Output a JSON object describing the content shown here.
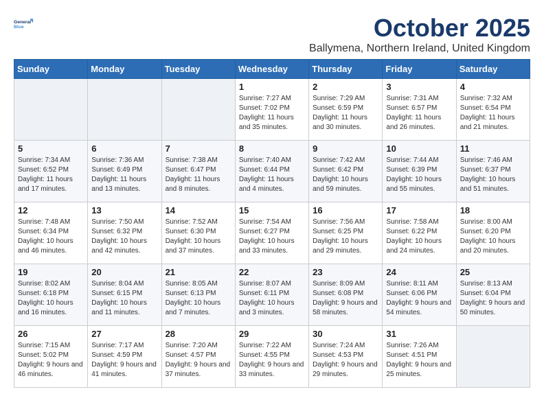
{
  "header": {
    "logo_line1": "General",
    "logo_line2": "Blue",
    "title": "October 2025",
    "subtitle": "Ballymena, Northern Ireland, United Kingdom"
  },
  "weekdays": [
    "Sunday",
    "Monday",
    "Tuesday",
    "Wednesday",
    "Thursday",
    "Friday",
    "Saturday"
  ],
  "weeks": [
    [
      {
        "day": "",
        "sunrise": "",
        "sunset": "",
        "daylight": ""
      },
      {
        "day": "",
        "sunrise": "",
        "sunset": "",
        "daylight": ""
      },
      {
        "day": "",
        "sunrise": "",
        "sunset": "",
        "daylight": ""
      },
      {
        "day": "1",
        "sunrise": "Sunrise: 7:27 AM",
        "sunset": "Sunset: 7:02 PM",
        "daylight": "Daylight: 11 hours and 35 minutes."
      },
      {
        "day": "2",
        "sunrise": "Sunrise: 7:29 AM",
        "sunset": "Sunset: 6:59 PM",
        "daylight": "Daylight: 11 hours and 30 minutes."
      },
      {
        "day": "3",
        "sunrise": "Sunrise: 7:31 AM",
        "sunset": "Sunset: 6:57 PM",
        "daylight": "Daylight: 11 hours and 26 minutes."
      },
      {
        "day": "4",
        "sunrise": "Sunrise: 7:32 AM",
        "sunset": "Sunset: 6:54 PM",
        "daylight": "Daylight: 11 hours and 21 minutes."
      }
    ],
    [
      {
        "day": "5",
        "sunrise": "Sunrise: 7:34 AM",
        "sunset": "Sunset: 6:52 PM",
        "daylight": "Daylight: 11 hours and 17 minutes."
      },
      {
        "day": "6",
        "sunrise": "Sunrise: 7:36 AM",
        "sunset": "Sunset: 6:49 PM",
        "daylight": "Daylight: 11 hours and 13 minutes."
      },
      {
        "day": "7",
        "sunrise": "Sunrise: 7:38 AM",
        "sunset": "Sunset: 6:47 PM",
        "daylight": "Daylight: 11 hours and 8 minutes."
      },
      {
        "day": "8",
        "sunrise": "Sunrise: 7:40 AM",
        "sunset": "Sunset: 6:44 PM",
        "daylight": "Daylight: 11 hours and 4 minutes."
      },
      {
        "day": "9",
        "sunrise": "Sunrise: 7:42 AM",
        "sunset": "Sunset: 6:42 PM",
        "daylight": "Daylight: 10 hours and 59 minutes."
      },
      {
        "day": "10",
        "sunrise": "Sunrise: 7:44 AM",
        "sunset": "Sunset: 6:39 PM",
        "daylight": "Daylight: 10 hours and 55 minutes."
      },
      {
        "day": "11",
        "sunrise": "Sunrise: 7:46 AM",
        "sunset": "Sunset: 6:37 PM",
        "daylight": "Daylight: 10 hours and 51 minutes."
      }
    ],
    [
      {
        "day": "12",
        "sunrise": "Sunrise: 7:48 AM",
        "sunset": "Sunset: 6:34 PM",
        "daylight": "Daylight: 10 hours and 46 minutes."
      },
      {
        "day": "13",
        "sunrise": "Sunrise: 7:50 AM",
        "sunset": "Sunset: 6:32 PM",
        "daylight": "Daylight: 10 hours and 42 minutes."
      },
      {
        "day": "14",
        "sunrise": "Sunrise: 7:52 AM",
        "sunset": "Sunset: 6:30 PM",
        "daylight": "Daylight: 10 hours and 37 minutes."
      },
      {
        "day": "15",
        "sunrise": "Sunrise: 7:54 AM",
        "sunset": "Sunset: 6:27 PM",
        "daylight": "Daylight: 10 hours and 33 minutes."
      },
      {
        "day": "16",
        "sunrise": "Sunrise: 7:56 AM",
        "sunset": "Sunset: 6:25 PM",
        "daylight": "Daylight: 10 hours and 29 minutes."
      },
      {
        "day": "17",
        "sunrise": "Sunrise: 7:58 AM",
        "sunset": "Sunset: 6:22 PM",
        "daylight": "Daylight: 10 hours and 24 minutes."
      },
      {
        "day": "18",
        "sunrise": "Sunrise: 8:00 AM",
        "sunset": "Sunset: 6:20 PM",
        "daylight": "Daylight: 10 hours and 20 minutes."
      }
    ],
    [
      {
        "day": "19",
        "sunrise": "Sunrise: 8:02 AM",
        "sunset": "Sunset: 6:18 PM",
        "daylight": "Daylight: 10 hours and 16 minutes."
      },
      {
        "day": "20",
        "sunrise": "Sunrise: 8:04 AM",
        "sunset": "Sunset: 6:15 PM",
        "daylight": "Daylight: 10 hours and 11 minutes."
      },
      {
        "day": "21",
        "sunrise": "Sunrise: 8:05 AM",
        "sunset": "Sunset: 6:13 PM",
        "daylight": "Daylight: 10 hours and 7 minutes."
      },
      {
        "day": "22",
        "sunrise": "Sunrise: 8:07 AM",
        "sunset": "Sunset: 6:11 PM",
        "daylight": "Daylight: 10 hours and 3 minutes."
      },
      {
        "day": "23",
        "sunrise": "Sunrise: 8:09 AM",
        "sunset": "Sunset: 6:08 PM",
        "daylight": "Daylight: 9 hours and 58 minutes."
      },
      {
        "day": "24",
        "sunrise": "Sunrise: 8:11 AM",
        "sunset": "Sunset: 6:06 PM",
        "daylight": "Daylight: 9 hours and 54 minutes."
      },
      {
        "day": "25",
        "sunrise": "Sunrise: 8:13 AM",
        "sunset": "Sunset: 6:04 PM",
        "daylight": "Daylight: 9 hours and 50 minutes."
      }
    ],
    [
      {
        "day": "26",
        "sunrise": "Sunrise: 7:15 AM",
        "sunset": "Sunset: 5:02 PM",
        "daylight": "Daylight: 9 hours and 46 minutes."
      },
      {
        "day": "27",
        "sunrise": "Sunrise: 7:17 AM",
        "sunset": "Sunset: 4:59 PM",
        "daylight": "Daylight: 9 hours and 41 minutes."
      },
      {
        "day": "28",
        "sunrise": "Sunrise: 7:20 AM",
        "sunset": "Sunset: 4:57 PM",
        "daylight": "Daylight: 9 hours and 37 minutes."
      },
      {
        "day": "29",
        "sunrise": "Sunrise: 7:22 AM",
        "sunset": "Sunset: 4:55 PM",
        "daylight": "Daylight: 9 hours and 33 minutes."
      },
      {
        "day": "30",
        "sunrise": "Sunrise: 7:24 AM",
        "sunset": "Sunset: 4:53 PM",
        "daylight": "Daylight: 9 hours and 29 minutes."
      },
      {
        "day": "31",
        "sunrise": "Sunrise: 7:26 AM",
        "sunset": "Sunset: 4:51 PM",
        "daylight": "Daylight: 9 hours and 25 minutes."
      },
      {
        "day": "",
        "sunrise": "",
        "sunset": "",
        "daylight": ""
      }
    ]
  ]
}
